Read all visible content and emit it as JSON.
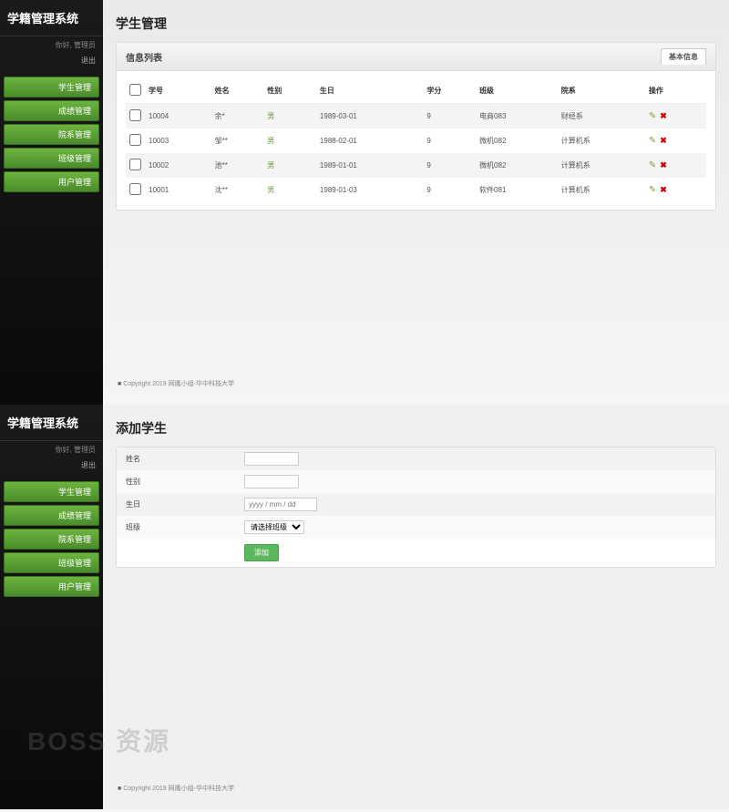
{
  "app": {
    "title": "学籍管理系统",
    "greeting": "你好, 管理员",
    "logout": "退出"
  },
  "nav": {
    "items": [
      {
        "label": "学生管理"
      },
      {
        "label": "成绩管理"
      },
      {
        "label": "院系管理"
      },
      {
        "label": "班级管理"
      },
      {
        "label": "用户管理"
      }
    ]
  },
  "panel1": {
    "title": "学生管理",
    "card_title": "信息列表",
    "tab": "基本信息",
    "columns": [
      "",
      "学号",
      "姓名",
      "性别",
      "生日",
      "学分",
      "班级",
      "院系",
      "操作"
    ],
    "rows": [
      {
        "id": "10004",
        "name": "余*",
        "gender": "男",
        "birth": "1989-03-01",
        "credit": "9",
        "class": "电商083",
        "dept": "财经系"
      },
      {
        "id": "10003",
        "name": "邹**",
        "gender": "男",
        "birth": "1988-02-01",
        "credit": "9",
        "class": "微机082",
        "dept": "计算机系"
      },
      {
        "id": "10002",
        "name": "池**",
        "gender": "男",
        "birth": "1989-01-01",
        "credit": "9",
        "class": "微机082",
        "dept": "计算机系"
      },
      {
        "id": "10001",
        "name": "沈**",
        "gender": "男",
        "birth": "1989-01-03",
        "credit": "9",
        "class": "软件081",
        "dept": "计算机系"
      }
    ]
  },
  "panel2": {
    "title": "添加学生",
    "fields": {
      "name_label": "姓名",
      "gender_label": "性别",
      "birth_label": "生日",
      "birth_placeholder": "yyyy / mm / dd",
      "class_label": "班级",
      "class_placeholder": "请选择班级",
      "submit": "添加"
    }
  },
  "footer": "Copyright 2019 网鹰小组-华中科技大学",
  "watermark": "BOSS 资源"
}
